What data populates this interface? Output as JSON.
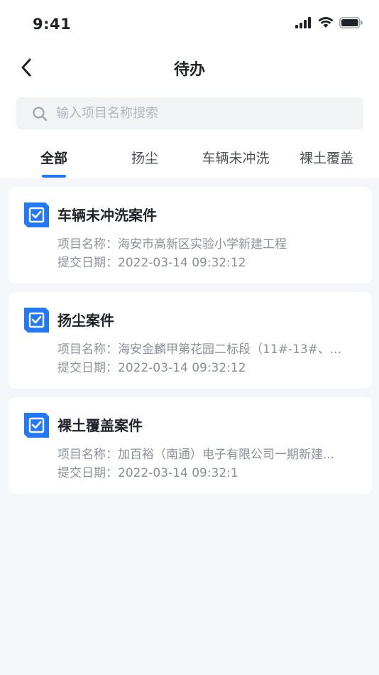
{
  "status_bar": {
    "time": "9:41"
  },
  "header": {
    "title": "待办"
  },
  "search": {
    "placeholder": "输入项目名称搜索"
  },
  "tabs": [
    {
      "label": "全部",
      "active": true
    },
    {
      "label": "扬尘",
      "active": false
    },
    {
      "label": "车辆未冲洗",
      "active": false
    },
    {
      "label": "裸土覆盖",
      "active": false
    }
  ],
  "cases": [
    {
      "title": "车辆未冲洗案件",
      "project": "项目名称：海安市高新区实验小学新建工程",
      "date": "提交日期：2022-03-14 09:32:12"
    },
    {
      "title": "扬尘案件",
      "project": "项目名称：海安金麟甲第花园二标段（11#-13#、...",
      "date": "提交日期：2022-03-14 09:32:12"
    },
    {
      "title": "裸土覆盖案件",
      "project": "项目名称：加百裕（南通）电子有限公司一期新建...",
      "date": "提交日期：2022-03-14 09:32:1"
    }
  ],
  "colors": {
    "accent": "#2378f7",
    "background": "#f4f6fa"
  },
  "icons": {
    "back": "chevron-left-icon",
    "search": "search-icon",
    "case": "checklist-icon"
  }
}
